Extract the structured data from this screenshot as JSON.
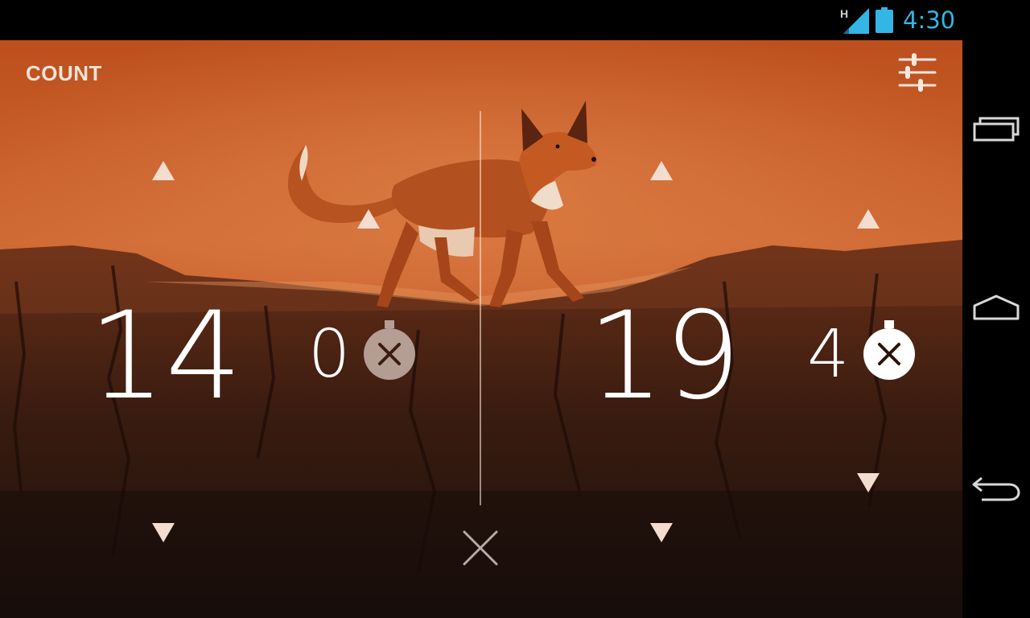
{
  "status_bar": {
    "network_type": "H",
    "time": "4:30",
    "clock_color": "#33b5e5",
    "signal_icon": "signal-bars-icon",
    "battery_icon": "battery-full-icon"
  },
  "app": {
    "title": "COUNT",
    "settings_icon": "sliders-icon",
    "close_icon": "close-x-icon"
  },
  "counters": {
    "left": {
      "main_value": "14",
      "secondary_value": "0",
      "timer_icon": "stopwatch-reset-icon",
      "timer_style": "dim"
    },
    "right": {
      "main_value": "19",
      "secondary_value": "4",
      "timer_icon": "stopwatch-reset-icon",
      "timer_style": "solid"
    }
  },
  "nav_bar": {
    "buttons": [
      "recent-apps-icon",
      "home-icon",
      "back-icon"
    ]
  },
  "colors": {
    "sky_top": "#c2541f",
    "sky_mid": "#d36a35",
    "cliff": "#3a1c10",
    "fox": "#b3501f"
  }
}
